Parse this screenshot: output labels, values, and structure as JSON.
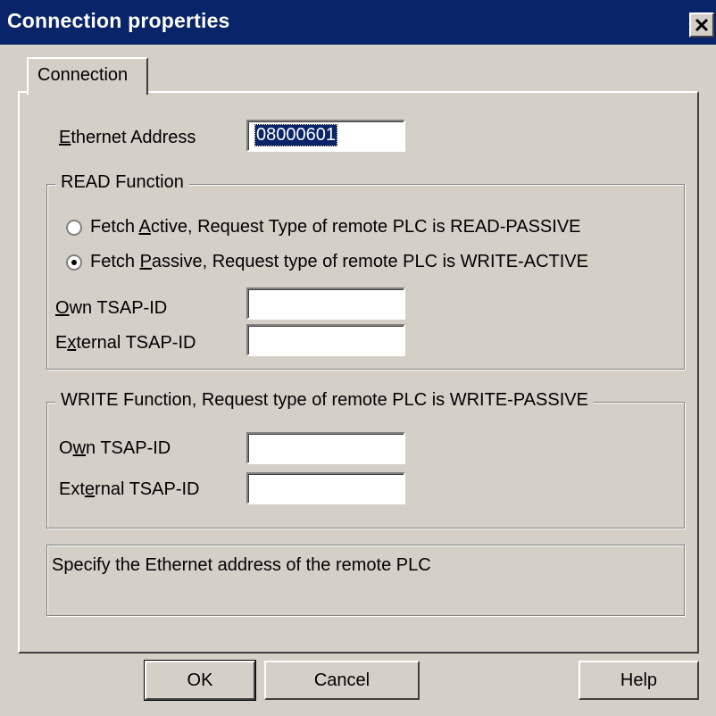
{
  "window": {
    "title": "Connection properties"
  },
  "tabs": [
    {
      "label": "Connection"
    }
  ],
  "ethernet": {
    "label_pre": "",
    "label_u": "E",
    "label_post": "thernet Address",
    "value": "08000601"
  },
  "read_function": {
    "title": "READ Function",
    "option1": {
      "pre": "Fetch ",
      "u": "A",
      "post": "ctive,   Request Type of remote PLC is READ-PASSIVE",
      "checked": false
    },
    "option2": {
      "pre": "Fetch ",
      "u": "P",
      "post": "assive, Request type of remote PLC is WRITE-ACTIVE",
      "checked": true
    },
    "own_tsap": {
      "u": "O",
      "post": "wn TSAP-ID",
      "value": ""
    },
    "ext_tsap": {
      "pre": "E",
      "u": "x",
      "post": "ternal TSAP-ID",
      "value": ""
    }
  },
  "write_function": {
    "title": "WRITE Function, Request type of remote PLC is WRITE-PASSIVE",
    "own_tsap": {
      "pre": "O",
      "u": "w",
      "post": "n TSAP-ID",
      "value": ""
    },
    "ext_tsap": {
      "pre": "Ext",
      "u": "e",
      "post": "rnal TSAP-ID",
      "value": ""
    }
  },
  "hint": {
    "text": "Specify the Ethernet address of the remote PLC"
  },
  "buttons": {
    "ok": "OK",
    "cancel": "Cancel",
    "help": "Help"
  },
  "colors": {
    "titlebar": "#0a246a",
    "face": "#d4d0c8",
    "selection": "#0a246a"
  }
}
